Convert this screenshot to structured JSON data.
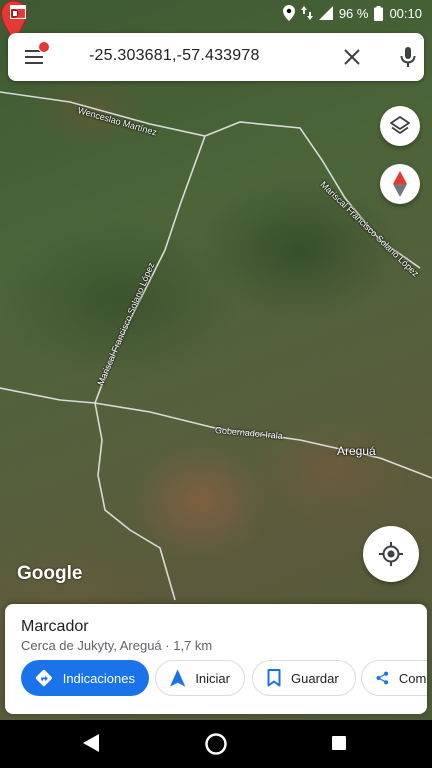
{
  "status_bar": {
    "battery": "96 %",
    "time": "00:10"
  },
  "search": {
    "query": "-25.303681,-57.433978"
  },
  "map": {
    "roads": {
      "wenceslao": "Wenceslao Martínez",
      "mariscal_right": "Mariscal Francisco Solano López",
      "mariscal_left": "Mariscal Francisco Solano López",
      "gobernador": "Gobernador Irala"
    },
    "place_label": "Areguá",
    "logo": "Google"
  },
  "place_card": {
    "title": "Marcador",
    "subtitle": "Cerca de Jukyty, Areguá · 1,7 km",
    "actions": {
      "directions": "Indicaciones",
      "start": "Iniciar",
      "save": "Guardar",
      "share": "Compartir"
    }
  },
  "colors": {
    "accent": "#1a73e8",
    "pin": "#e53935",
    "road": "#e8e8e8"
  },
  "icons": {
    "menu": "menu-icon",
    "clear": "close-icon",
    "mic": "microphone-icon",
    "layers": "layers-icon",
    "compass": "compass-icon",
    "location": "my-location-icon"
  }
}
